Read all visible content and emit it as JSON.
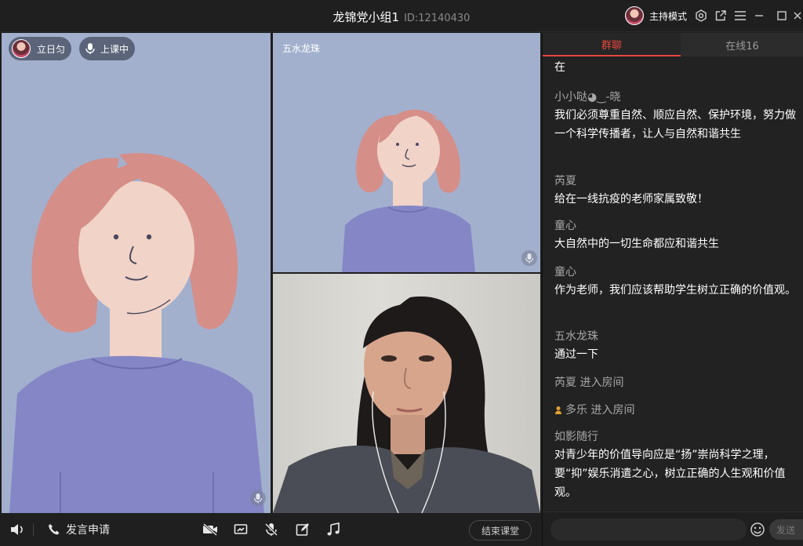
{
  "window": {
    "title": "龙锦党小组1",
    "room_id": "ID:12140430",
    "host_mode_label": "主持模式"
  },
  "main_tile": {
    "participant_name": "立日匀",
    "status_label": "上课中"
  },
  "top_right_tile": {
    "participant_name": "五水龙珠"
  },
  "toolbar": {
    "request_speak_label": "发言申请",
    "end_class_label": "结束课堂"
  },
  "chat_panel": {
    "tabs": [
      {
        "label": "群聊",
        "active": true
      },
      {
        "label": "在线16",
        "active": false
      }
    ],
    "partial_top_text": "在",
    "messages": [
      {
        "sender": "小小哒◕‿-晓",
        "text": "我们必须尊重自然、顺应自然、保护环境，努力做一个科学传播者，让人与自然和谐共生"
      },
      {
        "sender": "芮夏",
        "text": "给在一线抗疫的老师家属致敬！"
      },
      {
        "sender": "童心",
        "text": "大自然中的一切生命都应和谐共生"
      },
      {
        "sender": "童心",
        "text": "作为老师，我们应该帮助学生树立正确的价值观。"
      },
      {
        "sender": "五水龙珠",
        "text": "通过一下"
      },
      {
        "sender": "如影随行",
        "text": "对青少年的价值导向应是“扬”崇尚科学之理，要“抑”娱乐消遣之心，树立正确的人生观和价值观。"
      }
    ],
    "system_events": [
      {
        "text": "芮夏 进入房间"
      },
      {
        "text": "多乐 进入房间"
      }
    ],
    "send_label": "发送",
    "input_placeholder": ""
  },
  "colors": {
    "accent_red": "#e6473f",
    "tile_blue": "#a2b0ce",
    "panel_bg": "#222222"
  }
}
